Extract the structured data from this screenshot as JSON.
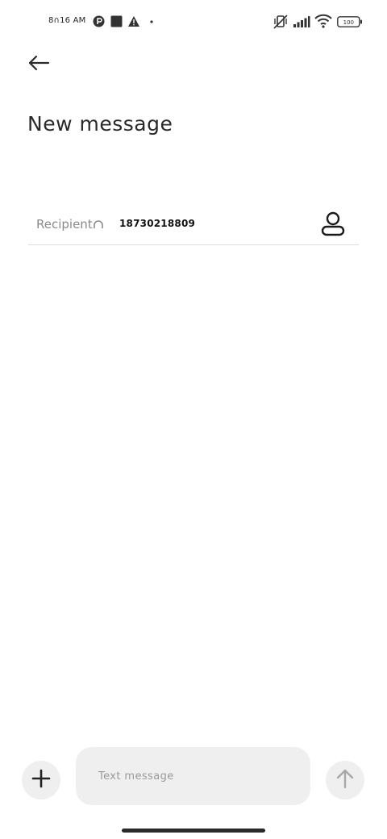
{
  "status_bar": {
    "time": "8∩16 AM",
    "battery_level": "100"
  },
  "header": {
    "title": "New message"
  },
  "recipient": {
    "label": "Recipient",
    "value": "18730218809"
  },
  "composer": {
    "placeholder": "Text message"
  },
  "icons": {
    "back": "arrow-left-icon",
    "contact": "person-icon",
    "attach": "plus-icon",
    "send": "arrow-up-icon"
  },
  "colors": {
    "background": "#ffffff",
    "field_background": "#efefef",
    "text_primary": "#222222",
    "text_muted": "#8a8a8a"
  }
}
